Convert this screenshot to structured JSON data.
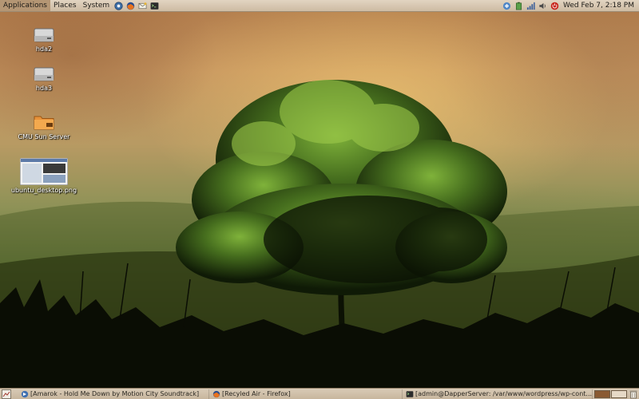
{
  "top_panel": {
    "menus": [
      "Applications",
      "Places",
      "System"
    ],
    "launchers": [
      "help-icon",
      "firefox-icon",
      "mail-icon",
      "terminal-icon"
    ],
    "tray_icons": [
      "network-icon",
      "battery-icon",
      "signal-icon",
      "volume-icon",
      "power-icon"
    ],
    "clock": "Wed Feb  7,  2:18 PM"
  },
  "desktop": {
    "icons": [
      {
        "label": "hda2",
        "icon": "drive-icon"
      },
      {
        "label": "hda3",
        "icon": "drive-icon"
      },
      {
        "label": "CMU Sun Server",
        "icon": "network-folder-icon"
      },
      {
        "label": "ubuntu_desktop.png",
        "icon": "image-thumbnail"
      }
    ]
  },
  "bottom_panel": {
    "tasks": [
      {
        "label": "[Amarok - Hold Me Down by Motion City Soundtrack]",
        "icon": "amarok-icon"
      },
      {
        "label": "[Recyled Air - Firefox]",
        "icon": "firefox-icon"
      },
      {
        "label": "[admin@DapperServer: /var/www/wordpress/wp-cont...",
        "icon": "terminal-icon"
      }
    ],
    "workspaces": 2
  },
  "colors": {
    "panel": "#d3c2aa",
    "active_workspace": "#8a5a32"
  }
}
